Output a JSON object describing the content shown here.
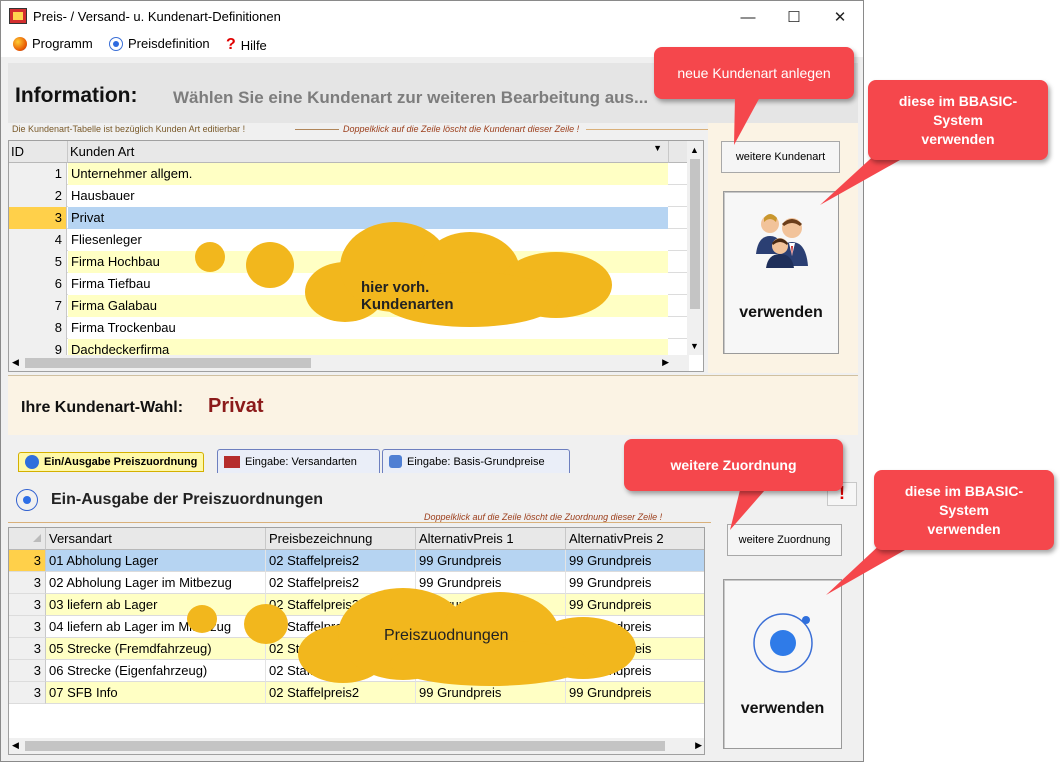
{
  "window": {
    "title": "Preis- / Versand- u. Kundenart-Definitionen",
    "controls": {
      "minimize": "—",
      "maximize": "☐",
      "close": "✕"
    }
  },
  "menu": {
    "items": [
      {
        "label": "Programm",
        "icon": "globe-icon"
      },
      {
        "label": "Preisdefinition",
        "icon": "radio-dot-icon"
      },
      {
        "label": "Hilfe",
        "icon": "help-question-icon"
      }
    ]
  },
  "info": {
    "title": "Information:",
    "text": "Wählen Sie eine Kundenart zur weiteren Bearbeitung aus...",
    "hint_left": "Die Kundenart-Tabelle ist bezüglich Kunden Art editierbar !",
    "hint_right": "Doppelklick auf die Zeile löscht die Kundenart dieser Zeile !"
  },
  "kunden_grid": {
    "headers": [
      "ID",
      "Kunden Art"
    ],
    "rows": [
      {
        "id": "1",
        "name": "Unternehmer allgem."
      },
      {
        "id": "2",
        "name": "Hausbauer"
      },
      {
        "id": "3",
        "name": "Privat"
      },
      {
        "id": "4",
        "name": "Fliesenleger"
      },
      {
        "id": "5",
        "name": "Firma Hochbau"
      },
      {
        "id": "6",
        "name": "Firma Tiefbau"
      },
      {
        "id": "7",
        "name": "Firma Galabau"
      },
      {
        "id": "8",
        "name": "Firma Trockenbau"
      },
      {
        "id": "9",
        "name": "Dachdeckerfirma"
      }
    ],
    "selected_index": 2
  },
  "kunden_panel": {
    "add_button": "weitere Kundenart",
    "use_button": "verwenden",
    "use_icon": "users-group-icon"
  },
  "wahl": {
    "label": "Ihre Kundenart-Wahl:",
    "value": "Privat"
  },
  "tabs": [
    {
      "label": "Ein/Ausgabe Preiszuordnung",
      "active": true
    },
    {
      "label": "Eingabe:  Versandarten",
      "active": false
    },
    {
      "label": "Eingabe: Basis-Grundpreise",
      "active": false
    }
  ],
  "lower": {
    "title": "Ein-Ausgabe der Preiszuordnungen",
    "hint": "Doppelklick auf die Zeile löscht die Zuordnung dieser Zeile !",
    "add_button": "weitere Zuordnung",
    "use_button": "verwenden",
    "warn_icon": "!"
  },
  "preis_grid": {
    "headers": [
      "",
      "Versandart",
      "Preisbezeichnung",
      "AlternativPreis 1",
      "AlternativPreis 2"
    ],
    "rows": [
      [
        "3",
        "01 Abholung Lager",
        "02 Staffelpreis2",
        "99 Grundpreis",
        "99 Grundpreis"
      ],
      [
        "3",
        "02 Abholung Lager im Mitbezug",
        "02 Staffelpreis2",
        "99 Grundpreis",
        "99 Grundpreis"
      ],
      [
        "3",
        "03 liefern ab Lager",
        "02 Staffelpreis2",
        "99 Grundpreis",
        "99 Grundpreis"
      ],
      [
        "3",
        "04 liefern ab Lager im Mitbezug",
        "02 Staffelpreis2",
        "99 Grundpreis",
        "99 Grundpreis"
      ],
      [
        "3",
        "05 Strecke (Fremdfahrzeug)",
        "02 Staffelpreis2",
        "99 Grundpreis",
        "99 Grundpreis"
      ],
      [
        "3",
        "06 Strecke (Eigenfahrzeug)",
        "02 Staffelpreis2",
        "99 Grundpreis",
        "99 Grundpreis"
      ],
      [
        "3",
        "07 SFB Info",
        "02 Staffelpreis2",
        "99 Grundpreis",
        "99 Grundpreis"
      ]
    ],
    "selected_index": 0
  },
  "annotations": {
    "callout_new": "neue Kundenart anlegen",
    "callout_use1": "diese im BBASIC-\nSystem\nverwenden",
    "callout_more": "weitere Zuordnung",
    "callout_use2": "diese im BBASIC-\nSystem\nverwenden",
    "cloud1": "hier vorh. Kundenarten",
    "cloud2": "Preiszuodnungen"
  },
  "colors": {
    "callout": "#f5474c",
    "cloud": "#f2b71d",
    "selected_row": "#b6d4f2",
    "yellow_row": "#ffffc4",
    "wahl_value": "#8b1a1a"
  }
}
